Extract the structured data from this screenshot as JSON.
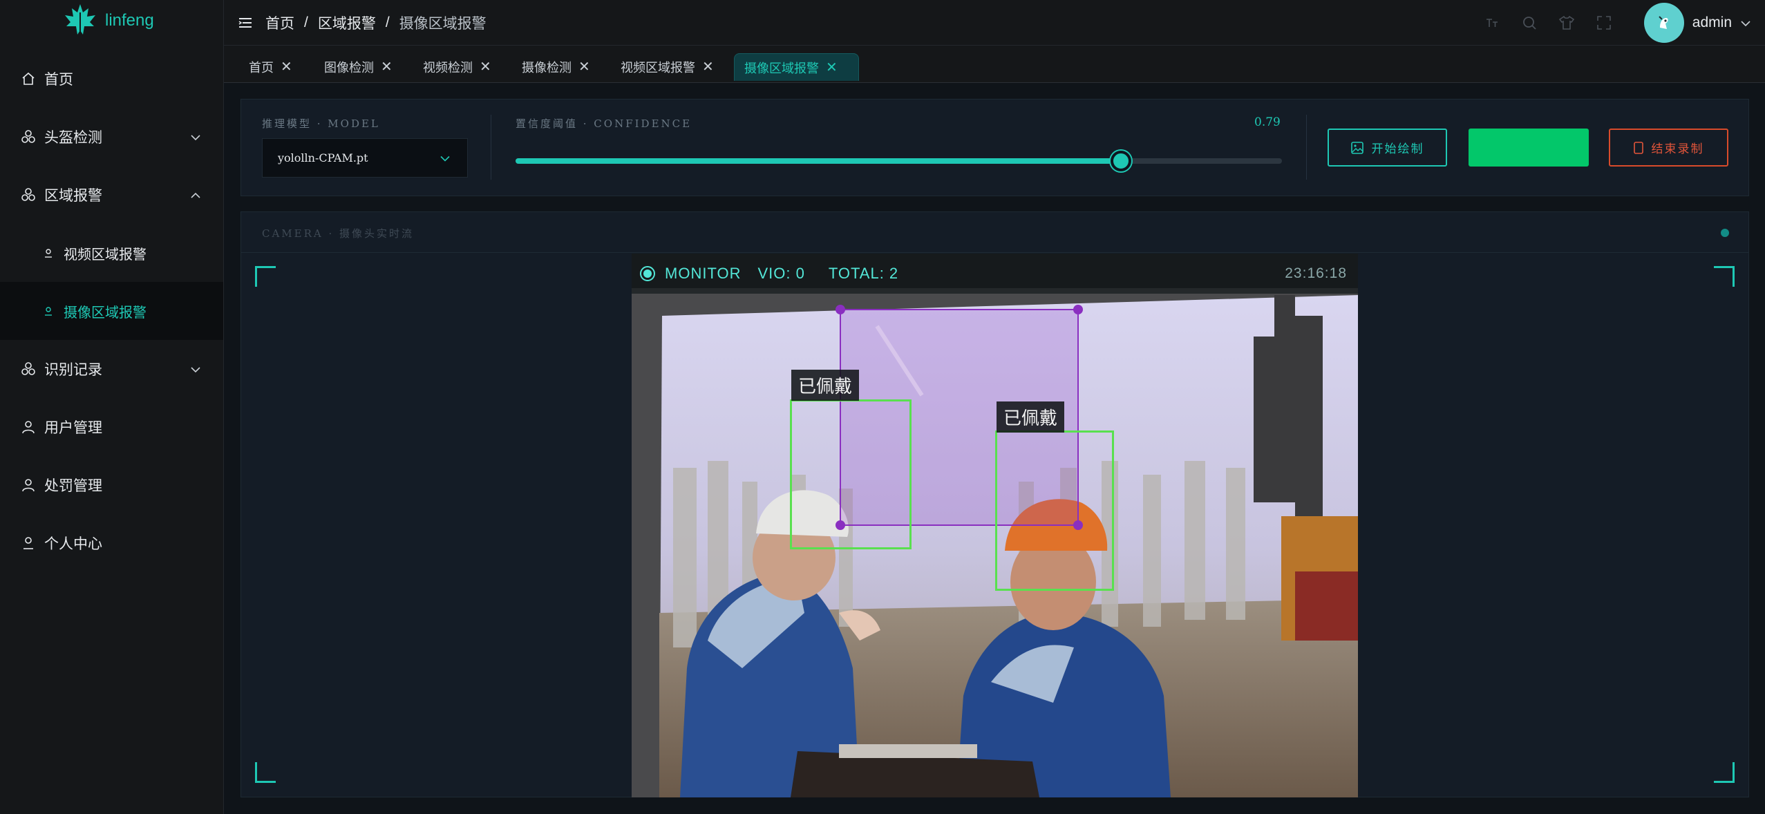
{
  "app": {
    "name": "linfeng"
  },
  "sidebar": {
    "items": [
      {
        "label": "首页",
        "icon": "home-icon",
        "expandable": false
      },
      {
        "label": "头盔检测",
        "icon": "cluster-icon",
        "expandable": true,
        "expanded": false
      },
      {
        "label": "区域报警",
        "icon": "cluster-icon",
        "expandable": true,
        "expanded": true
      },
      {
        "label": "视频区域报警",
        "icon": "user-small-icon",
        "sub": true
      },
      {
        "label": "摄像区域报警",
        "icon": "user-small-icon",
        "sub": true,
        "active": true
      },
      {
        "label": "识别记录",
        "icon": "cluster-icon",
        "expandable": true,
        "expanded": false
      },
      {
        "label": "用户管理",
        "icon": "user-icon",
        "expandable": false
      },
      {
        "label": "处罚管理",
        "icon": "user-icon",
        "expandable": false
      },
      {
        "label": "个人中心",
        "icon": "user-icon",
        "expandable": false
      }
    ]
  },
  "header": {
    "breadcrumb": [
      "首页",
      "区域报警",
      "摄像区域报警"
    ],
    "separator": "/",
    "user": "admin"
  },
  "tabs": [
    {
      "label": "首页",
      "active": false
    },
    {
      "label": "图像检测",
      "active": false
    },
    {
      "label": "视频检测",
      "active": false
    },
    {
      "label": "摄像检测",
      "active": false
    },
    {
      "label": "视频区域报警",
      "active": false
    },
    {
      "label": "摄像区域报警",
      "active": true
    }
  ],
  "controls": {
    "model_caption": "推理模型 · MODEL",
    "model_value": "yololln-CPAM.pt",
    "confidence_caption": "置信度阈值 · CONFIDENCE",
    "confidence_value": "0.79",
    "confidence": 0.79,
    "start_draw_label": "开始绘制",
    "green_button_label": "",
    "stop_record_label": "结束录制"
  },
  "camera": {
    "caption": "CAMERA · 摄像头实时流",
    "hud_monitor": "MONITOR",
    "hud_vio": "VIO: 0",
    "hud_total": "TOTAL: 2",
    "hud_time": "23:16:18",
    "detections": [
      {
        "label": "已佩戴"
      },
      {
        "label": "已佩戴"
      }
    ]
  },
  "colors": {
    "accent": "#1ec8b4",
    "sidebar_bg": "#151719",
    "panel_bg": "#141c26",
    "green_button": "#03c76a",
    "stop_button": "#e2553a",
    "detection_box": "#59e04f",
    "zone_polygon": "#8a2fc0"
  }
}
